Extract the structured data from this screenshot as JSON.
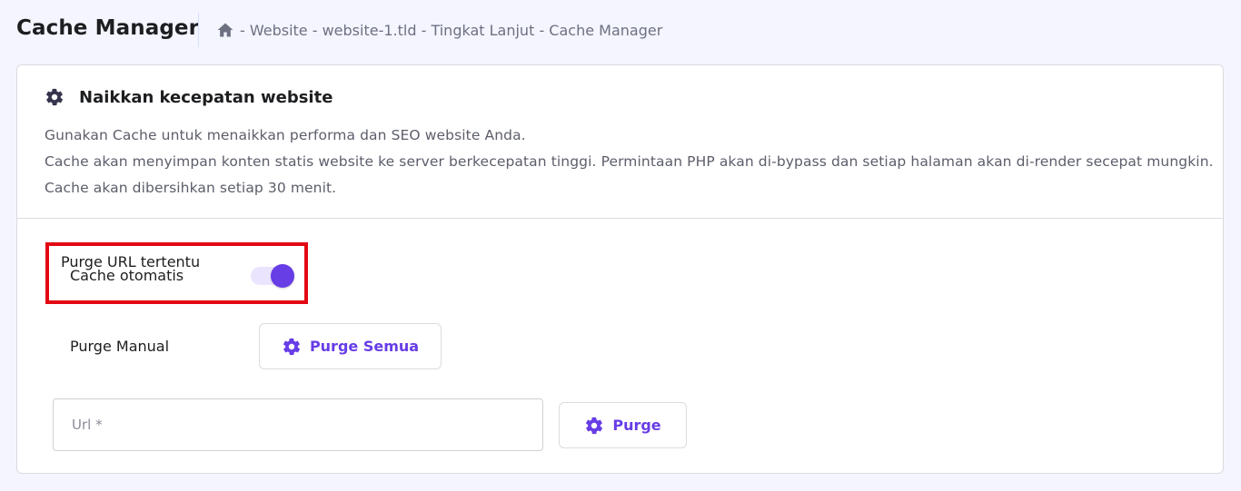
{
  "header": {
    "title": "Cache Manager",
    "breadcrumb": [
      "- Website",
      "- website-1.tld",
      "- Tingkat Lanjut",
      "- Cache Manager"
    ]
  },
  "card": {
    "title": "Naikkan kecepatan website",
    "description": [
      "Gunakan Cache untuk menaikkan performa dan SEO website Anda.",
      "Cache akan menyimpan konten statis website ke server berkecepatan tinggi. Permintaan PHP akan di-bypass dan setiap halaman akan di-render secepat mungkin.",
      "Cache akan dibersihkan setiap 30 menit."
    ]
  },
  "settings": {
    "purge_url_label": "Purge URL tertentu",
    "auto_cache_label": "Cache otomatis",
    "auto_cache_enabled": true,
    "manual_purge_label": "Purge Manual",
    "purge_all_button": "Purge Semua",
    "url_input_placeholder": "Url *",
    "url_input_value": "",
    "purge_button": "Purge"
  },
  "colors": {
    "accent": "#673de6",
    "toggle_track": "#ebe4ff",
    "highlight": "#e30613",
    "background": "#f4f5ff"
  },
  "icons": {
    "home": "home-icon",
    "gear": "gear-icon"
  }
}
